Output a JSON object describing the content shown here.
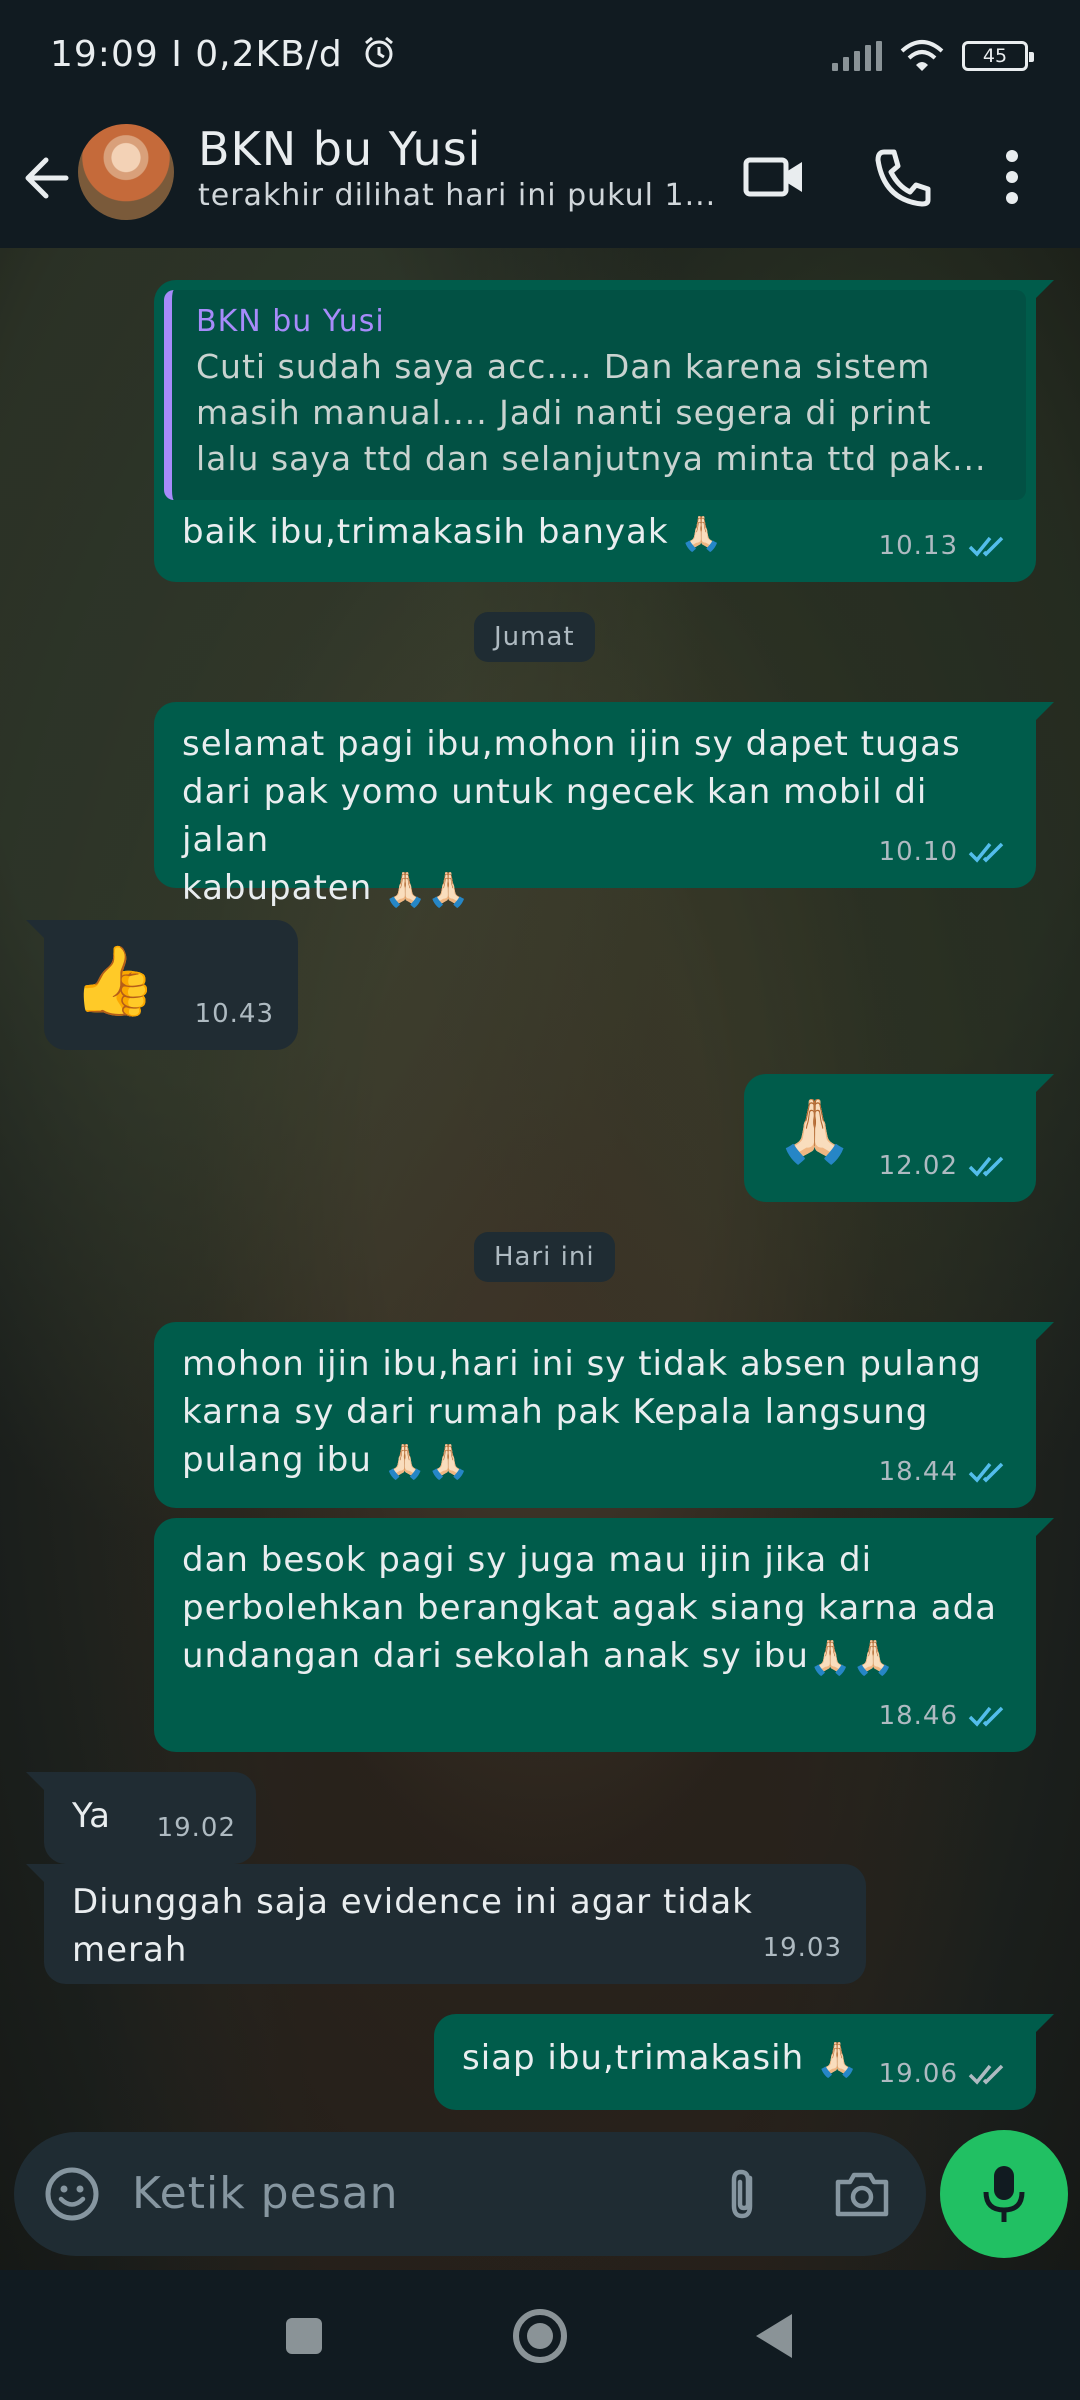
{
  "status_bar": {
    "time": "19:09 I 0,2KB/d",
    "battery": "45"
  },
  "header": {
    "contact_name": "BKN bu Yusi",
    "last_seen": "terakhir dilihat hari ini pukul 1..."
  },
  "messages": [
    {
      "type": "outgoing",
      "quote_author": "BKN bu Yusi",
      "quote_lines": [
        "Cuti sudah saya acc.... Dan karena sistem",
        "masih manual.... Jadi nanti segera di print",
        "lalu saya ttd dan selanjutnya minta ttd pak..."
      ],
      "text": "baik ibu,trimakasih banyak",
      "emoji": "🙏🏻",
      "time": "10.13",
      "status": "read"
    },
    {
      "type": "date",
      "text": "Jumat"
    },
    {
      "type": "outgoing",
      "lines": [
        "selamat pagi ibu,mohon ijin sy dapet tugas",
        "dari pak yomo untuk ngecek kan mobil di jalan",
        "kabupaten"
      ],
      "emoji": "🙏🏻🙏🏻",
      "time": "10.10",
      "status": "read"
    },
    {
      "type": "incoming",
      "emoji": "👍",
      "time": "10.43"
    },
    {
      "type": "outgoing",
      "emoji": "🙏🏻",
      "time": "12.02",
      "status": "read"
    },
    {
      "type": "date",
      "text": "Hari ini"
    },
    {
      "type": "outgoing",
      "lines": [
        "mohon ijin ibu,hari ini sy tidak absen pulang",
        "karna sy dari rumah pak Kepala langsung",
        "pulang ibu"
      ],
      "emoji": "🙏🏻🙏🏻",
      "time": "18.44",
      "status": "read"
    },
    {
      "type": "outgoing",
      "lines": [
        "dan besok pagi sy juga mau ijin jika di",
        "perbolehkan berangkat agak siang karna ada",
        "undangan dari sekolah anak sy ibu"
      ],
      "emoji": "🙏🏻🙏🏻",
      "time": "18.46",
      "status": "read"
    },
    {
      "type": "incoming",
      "text": "Ya",
      "time": "19.02"
    },
    {
      "type": "incoming",
      "text": "Diunggah saja evidence ini agar tidak merah",
      "time": "19.03"
    },
    {
      "type": "outgoing",
      "text": "siap ibu,trimakasih",
      "emoji": "🙏🏻",
      "time": "19.06",
      "status": "delivered"
    }
  ],
  "input": {
    "placeholder": "Ketik pesan"
  },
  "colors": {
    "outgoing_bubble": "#005c4b",
    "incoming_bubble": "#202c33",
    "read_ticks": "#53bdeb",
    "mic_button": "#21c063",
    "quote_accent": "#a78bfa"
  },
  "icons": [
    "back-arrow-icon",
    "video-call-icon",
    "phone-icon",
    "more-vert-icon",
    "emoji-icon",
    "attach-icon",
    "camera-icon",
    "mic-icon",
    "nav-recents-icon",
    "nav-home-icon",
    "nav-back-icon"
  ]
}
